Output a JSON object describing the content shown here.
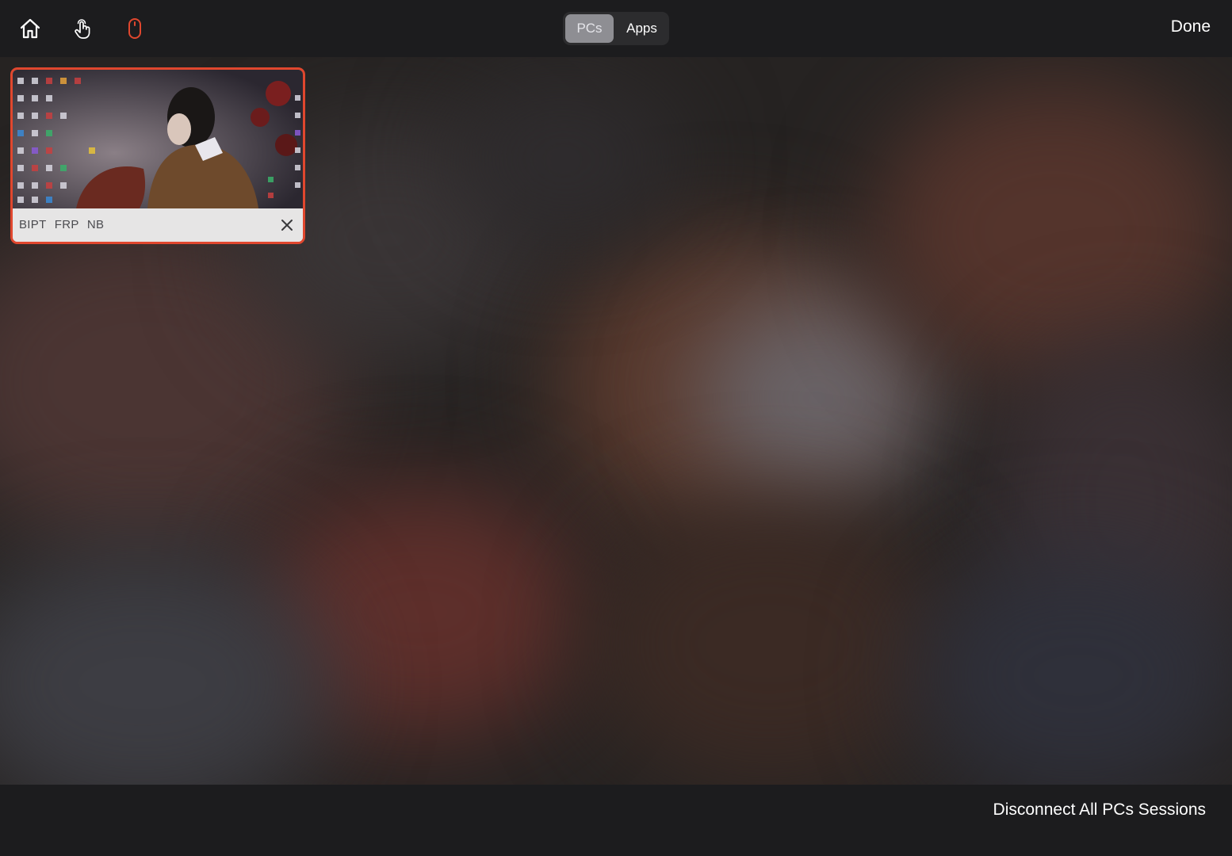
{
  "toolbar": {
    "home_icon": "home-icon",
    "touch_icon": "touch-hand-icon",
    "mouse_icon": "mouse-icon",
    "accent_color": "#e0472e",
    "tabs": [
      {
        "label": "PCs",
        "selected": true
      },
      {
        "label": "Apps",
        "selected": false
      }
    ],
    "done_label": "Done"
  },
  "sessions": [
    {
      "name": "BIPT   FRP   NB",
      "close_icon": "close-icon",
      "selected": true
    }
  ],
  "footer": {
    "disconnect_label": "Disconnect All PCs Sessions"
  }
}
